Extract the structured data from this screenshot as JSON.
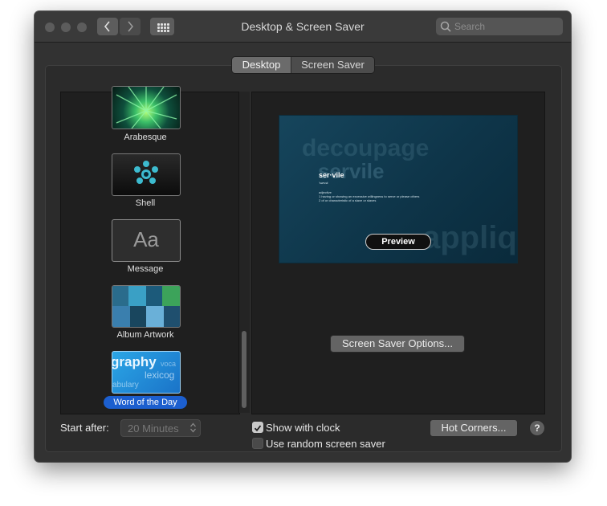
{
  "window": {
    "title": "Desktop & Screen Saver",
    "search_placeholder": "Search",
    "nav_back": "back",
    "nav_forward": "forward"
  },
  "tabs": [
    {
      "label": "Desktop",
      "selected": false
    },
    {
      "label": "Screen Saver",
      "selected": true
    }
  ],
  "screensavers": [
    {
      "label": "Arabesque",
      "icon": "arabesque-thumbnail",
      "selected": false
    },
    {
      "label": "Shell",
      "icon": "shell-thumbnail",
      "selected": false
    },
    {
      "label": "Message",
      "icon": "message-thumbnail",
      "selected": false,
      "thumb_text": "Aa"
    },
    {
      "label": "Album Artwork",
      "icon": "album-artwork-thumbnail",
      "selected": false
    },
    {
      "label": "Word of the Day",
      "icon": "word-of-the-day-thumbnail",
      "selected": true
    }
  ],
  "preview": {
    "word": "ser·vile",
    "pronunciation": "'sərvəl",
    "part_of_speech": "adjective",
    "definition_1": "1  having or showing an excessive willingness to serve or please others",
    "definition_2": "2  of or characteristic of a slave or slaves",
    "bg_word_1": "decoupage",
    "bg_word_2": "servile",
    "bg_word_3": "appliq",
    "button_label": "Preview"
  },
  "options_button": "Screen Saver Options...",
  "start_after": {
    "label": "Start after:",
    "value": "20 Minutes"
  },
  "show_with_clock": {
    "label": "Show with clock",
    "checked": true
  },
  "use_random": {
    "label": "Use random screen saver",
    "checked": false
  },
  "hot_corners_button": "Hot Corners...",
  "help_button": "?",
  "colors": {
    "window_bg": "#323232",
    "accent_selected": "#1c5fcf"
  }
}
